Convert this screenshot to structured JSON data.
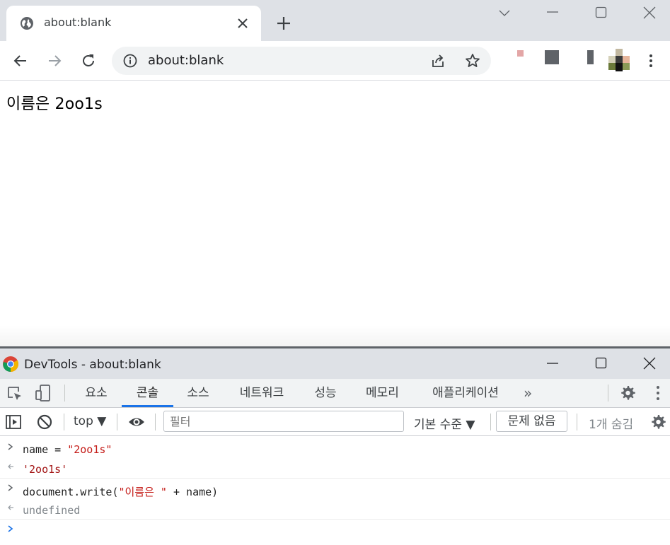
{
  "browser": {
    "tab_title": "about:blank",
    "address": "about:blank"
  },
  "page": {
    "content": "이름은 2oo1s"
  },
  "devtools": {
    "window_title": "DevTools - about:blank",
    "tabs": [
      {
        "label": "요소"
      },
      {
        "label": "콘솔",
        "active": true
      },
      {
        "label": "소스"
      },
      {
        "label": "네트워크"
      },
      {
        "label": "성능"
      },
      {
        "label": "메모리"
      },
      {
        "label": "애플리케이션"
      }
    ],
    "more_tabs": "»",
    "context": "top ▼",
    "filter_placeholder": "필터",
    "level": "기본 수준 ▼",
    "issues": "문제 없음",
    "hidden": "1개 숨김",
    "accent_color": "#1a73e8"
  },
  "console": {
    "input1_prefix": "name = ",
    "input1_string": "\"2oo1s\"",
    "result1": "'2oo1s'",
    "input2_prefix": "document.write(",
    "input2_string": "\"이름은 \"",
    "input2_suffix": " + name)",
    "result2": "undefined"
  }
}
